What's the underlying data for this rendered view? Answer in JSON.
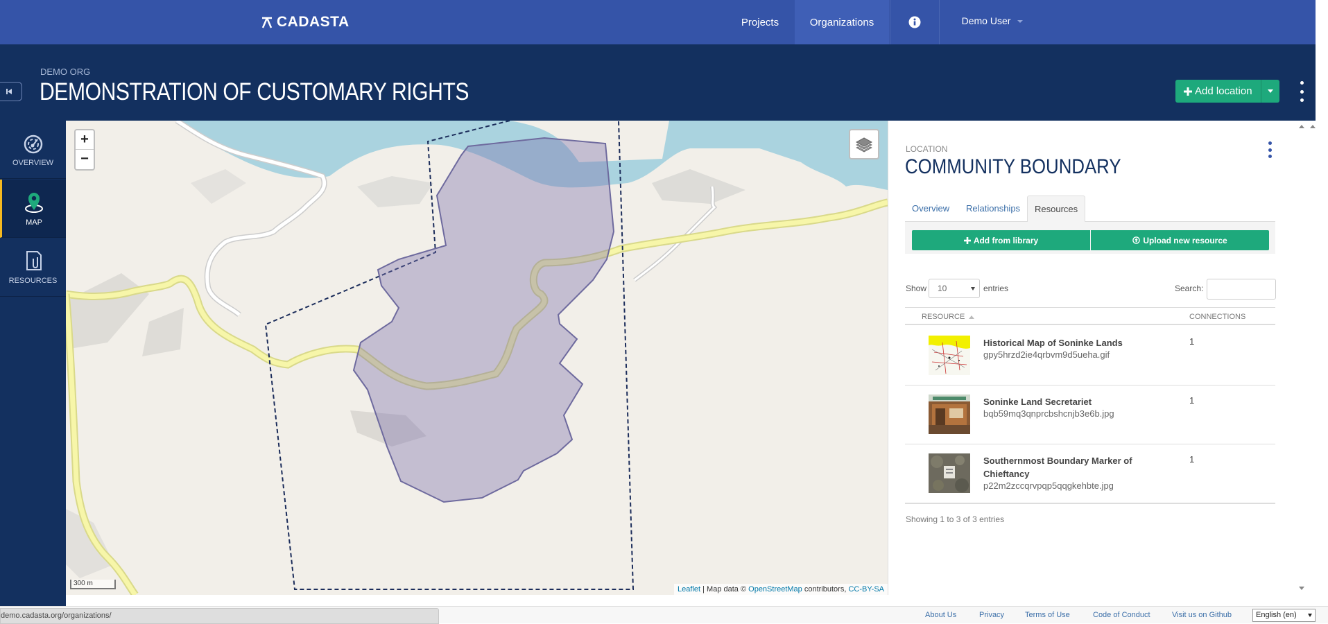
{
  "topnav": {
    "brand": "CADASTA",
    "links": [
      "Projects",
      "Organizations"
    ],
    "user": "Demo User"
  },
  "header": {
    "org_name": "DEMO ORG",
    "project_title": "DEMONSTRATION OF CUSTOMARY RIGHTS",
    "add_location_label": "Add location"
  },
  "sidebar": {
    "items": [
      {
        "label": "OVERVIEW",
        "icon": "dashboard-icon"
      },
      {
        "label": "MAP",
        "icon": "map-pin-icon",
        "active": true
      },
      {
        "label": "RESOURCES",
        "icon": "attachment-icon"
      }
    ]
  },
  "map": {
    "zoom_in": "+",
    "zoom_out": "−",
    "scale": "300 m",
    "attribution": {
      "leaflet": "Leaflet",
      "text1": " | Map data © ",
      "osm": "OpenStreetMap",
      "text2": " contributors, ",
      "license": "CC-BY-SA"
    }
  },
  "panel": {
    "type_label": "LOCATION",
    "title": "COMMUNITY BOUNDARY",
    "tabs": [
      "Overview",
      "Relationships",
      "Resources"
    ],
    "active_tab": "Resources",
    "add_library_label": "Add from library",
    "upload_label": "Upload new resource",
    "show_label": "Show",
    "entries_value": "10",
    "entries_label": "entries",
    "search_label": "Search:",
    "columns": [
      "RESOURCE",
      "CONNECTIONS"
    ],
    "rows": [
      {
        "name": "Historical Map of Soninke Lands",
        "file": "gpy5hrzd2ie4qrbvm9d5ueha.gif",
        "connections": "1"
      },
      {
        "name": "Soninke Land Secretariet",
        "file": "bqb59mq3qnprcbshcnjb3e6b.jpg",
        "connections": "1"
      },
      {
        "name": "Southernmost Boundary Marker of Chieftancy",
        "file": "p22m2zccqrvpqp5qqgkehbte.jpg",
        "connections": "1"
      }
    ],
    "showing": "Showing 1 to 3 of 3 entries"
  },
  "footer": {
    "status_url": "demo.cadasta.org/organizations/",
    "links": [
      "About Us",
      "Privacy",
      "Terms of Use",
      "Code of Conduct",
      "Visit us on Github"
    ],
    "language": "English (en)"
  },
  "colors": {
    "nav_blue": "#3554a8",
    "header_navy": "#13305f",
    "accent_green": "#1ea97c",
    "active_yellow": "#f5b920"
  }
}
